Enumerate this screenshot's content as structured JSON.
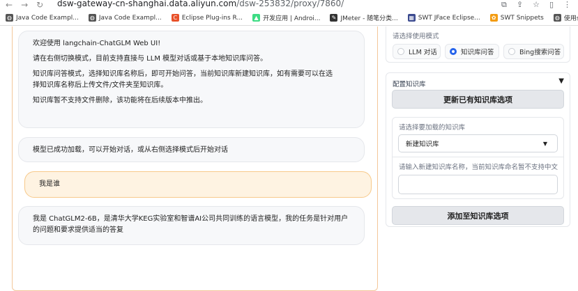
{
  "browser": {
    "url_host": "dsw-gateway-cn-shanghai.data.aliyun.com",
    "url_path": "/dsw-253832/proxy/7860/",
    "bookmarks": [
      {
        "label": "Java Code Exampl...",
        "icon": "globe-icon",
        "color": "#555555"
      },
      {
        "label": "Java Code Exampl...",
        "icon": "globe-icon",
        "color": "#555555"
      },
      {
        "label": "Eclipse Plug-ins R...",
        "icon": "c-logo-icon",
        "color": "#e8512a"
      },
      {
        "label": "开发应用 | Androi...",
        "icon": "android-icon",
        "color": "#3ddc84"
      },
      {
        "label": "JMeter - 随笔分类...",
        "icon": "feather-icon",
        "color": "#333333"
      },
      {
        "label": "SWT JFace Eclipse...",
        "icon": "swt-icon",
        "color": "#3b4a8f"
      },
      {
        "label": "SWT Snippets",
        "icon": "snippet-icon",
        "color": "#f39c12"
      },
      {
        "label": "使用shadowsocks...",
        "icon": "globe-icon",
        "color": "#555555"
      }
    ]
  },
  "chat": {
    "welcome": {
      "line1": "欢迎使用 langchain-ChatGLM Web UI!",
      "line2": "请在右侧切换模式，目前支持直接与 LLM 模型对话或基于本地知识库问答。",
      "line3a": "知识库问答模式，选择知识库名称后，即可开始问答，当前知识库新建知识库，如有需要可以在选",
      "line3b": "择知识库名称后上传文件/文件夹至知识库。",
      "line4": "知识库暂不支持文件删除，该功能将在后续版本中推出。"
    },
    "loaded_msg": "模型已成功加载，可以开始对话，或从右侧选择模式后开始对话",
    "user_msg": "我是谁",
    "bot_reply_a": "我是 ChatGLM2-6B，是清华大学KEG实验室和智谱AI公司共同训练的语言模型，我的任务是针对用户",
    "bot_reply_b": "的问题和要求提供适当的答复"
  },
  "mode": {
    "label": "请选择使用模式",
    "options": [
      "LLM 对话",
      "知识库问答",
      "Bing搜索问答"
    ],
    "selected": "知识库问答"
  },
  "kb": {
    "title": "配置知识库",
    "update_button": "更新已有知识库选项",
    "select_label": "请选择要加载的知识库",
    "select_value": "新建知识库",
    "name_label": "请输入新建知识库名称，当前知识库命名暂不支持中文",
    "name_value": "",
    "add_button": "添加至知识库选项"
  },
  "colors": {
    "accent": "#2563eb",
    "chat_border": "#f3c79a",
    "user_bubble": "#fef3e2"
  }
}
